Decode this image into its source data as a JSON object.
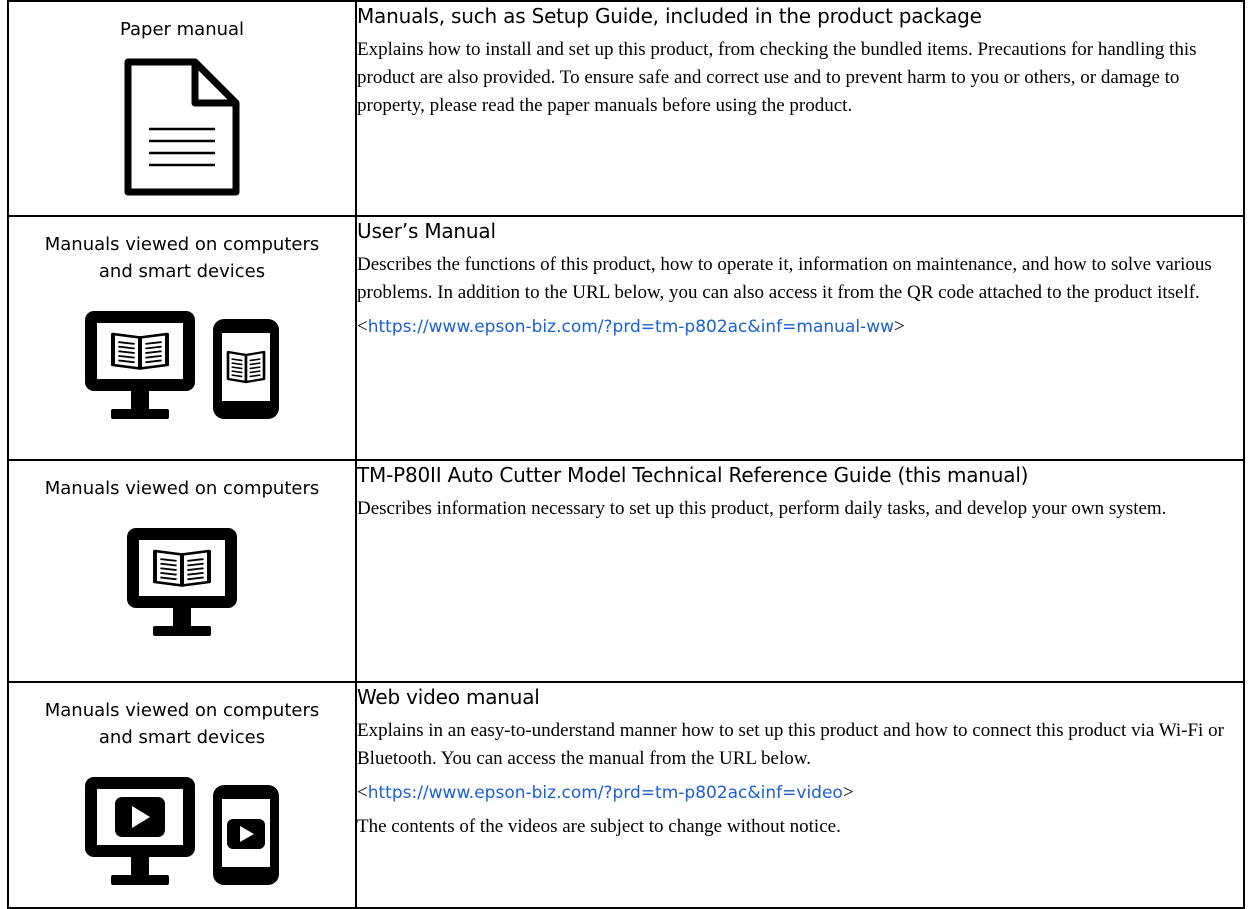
{
  "rows": [
    {
      "kind_lines": [
        "Paper manual"
      ],
      "icon": "paper-document-icon",
      "title": "Manuals, such as Setup Guide, included in the product package",
      "paragraphs": [
        "Explains how to install and set up this product, from checking the bundled items. Precautions for handling this product are also provided. To ensure safe and correct use and to prevent harm to you or others, or damage to property, please read the paper manuals before using the product."
      ]
    },
    {
      "kind_lines": [
        "Manuals viewed on computers",
        "and smart devices"
      ],
      "icons": [
        "monitor-book-icon",
        "tablet-book-icon"
      ],
      "title": "User’s Manual",
      "paragraphs": [
        "Describes the functions of this product, how to operate it, information on maintenance, and how to solve various problems. In addition to the URL below, you can also access it from the QR code attached to the product itself."
      ],
      "link_open": "<",
      "link": "https://www.epson-biz.com/?prd=tm-p802ac&inf=manual-ww",
      "link_close": ">"
    },
    {
      "kind_lines": [
        "Manuals viewed on computers"
      ],
      "icons": [
        "monitor-book-icon"
      ],
      "title": "TM-P80II Auto Cutter Model Technical Reference Guide (this manual)",
      "paragraphs": [
        "Describes information necessary to set up this product, perform daily tasks, and develop your own system."
      ]
    },
    {
      "kind_lines": [
        "Manuals viewed on computers",
        "and smart devices"
      ],
      "icons": [
        "monitor-play-icon",
        "tablet-play-icon"
      ],
      "title": "Web video manual",
      "paragraphs": [
        "Explains in an easy-to-understand manner how to set up this product and how to connect this product via Wi-Fi or Bluetooth. You can access the manual from the URL below."
      ],
      "link_open": "<",
      "link": "https://www.epson-biz.com/?prd=tm-p802ac&inf=video",
      "link_close": ">",
      "note": "The contents of the videos are subject to change without notice."
    }
  ]
}
